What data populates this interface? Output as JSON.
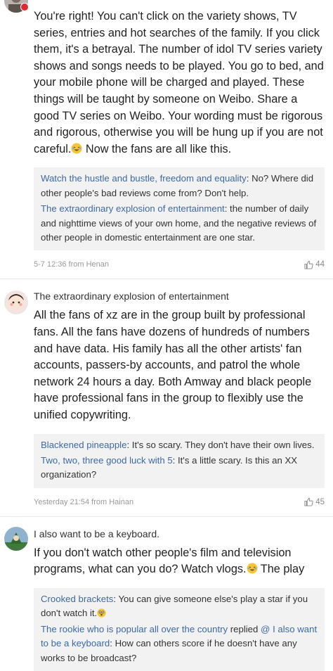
{
  "posts": [
    {
      "content_before_emoji": "You're right! You can't click on the variety shows, TV series, entries and hot searches of the family. If you click them, it's a betrayal. The number of idol TV series variety shows and songs needs to be played. You go to bed, and your mobile phone will be charged and played. These things will be taught by someone on Weibo. Share a good TV series on Weibo. Your wording must be rigorous and rigorous, otherwise you will be hung up if you are not careful.",
      "content_after_emoji": " Now the fans are all like this.",
      "replies": [
        {
          "name": "Watch the hustle and bustle, freedom and equality",
          "text": ": No? Where did other people's bad reviews come from? Don't help."
        },
        {
          "name": "The extraordinary explosion of entertainment",
          "text": ": the number of daily and nighttime views of your own home, and the negative reviews of other people in domestic entertainment are one star."
        }
      ],
      "time": "5-7 12:36 from Henan",
      "likes": "44"
    },
    {
      "author": "The extraordinary explosion of entertainment",
      "content": "All the fans of xz are in the group built by professional fans. All the fans have dozens of hundreds of numbers and have data. His family has all the other artists' fan accounts, passers-by accounts, and patrol the whole network 24 hours a day. Both Amway and black people have professional fans in the group to flexibly use the unified copywriting.",
      "replies": [
        {
          "name": "Blackened pineapple",
          "text": ": It's so scary. They don't have their own lives."
        },
        {
          "name": "Two, two, three good luck with 5",
          "text": ": It's a little scary. Is this an XX organization?"
        }
      ],
      "time": "Yesterday 21:54 from Hainan",
      "likes": "45"
    },
    {
      "author": "I also want to be a keyboard.",
      "content_before_emoji": "If you don't watch other people's film and television programs, what can you do? Watch vlogs.",
      "content_after_emoji": " The play",
      "replies": [
        {
          "name": "Crooked brackets",
          "text": ": You can give someone else's play a star if you don't watch it."
        },
        {
          "name": "The rookie who is popular all over the country",
          "mid": " replied ",
          "mention": "@ I also want to be a keyboard",
          "text": ": How can others score if he doesn't have any works to be broadcast?"
        }
      ]
    }
  ],
  "colors": {
    "link": "#3a6aa8",
    "reply_bg": "#f2f2f2",
    "meta": "#9a9a9a"
  }
}
